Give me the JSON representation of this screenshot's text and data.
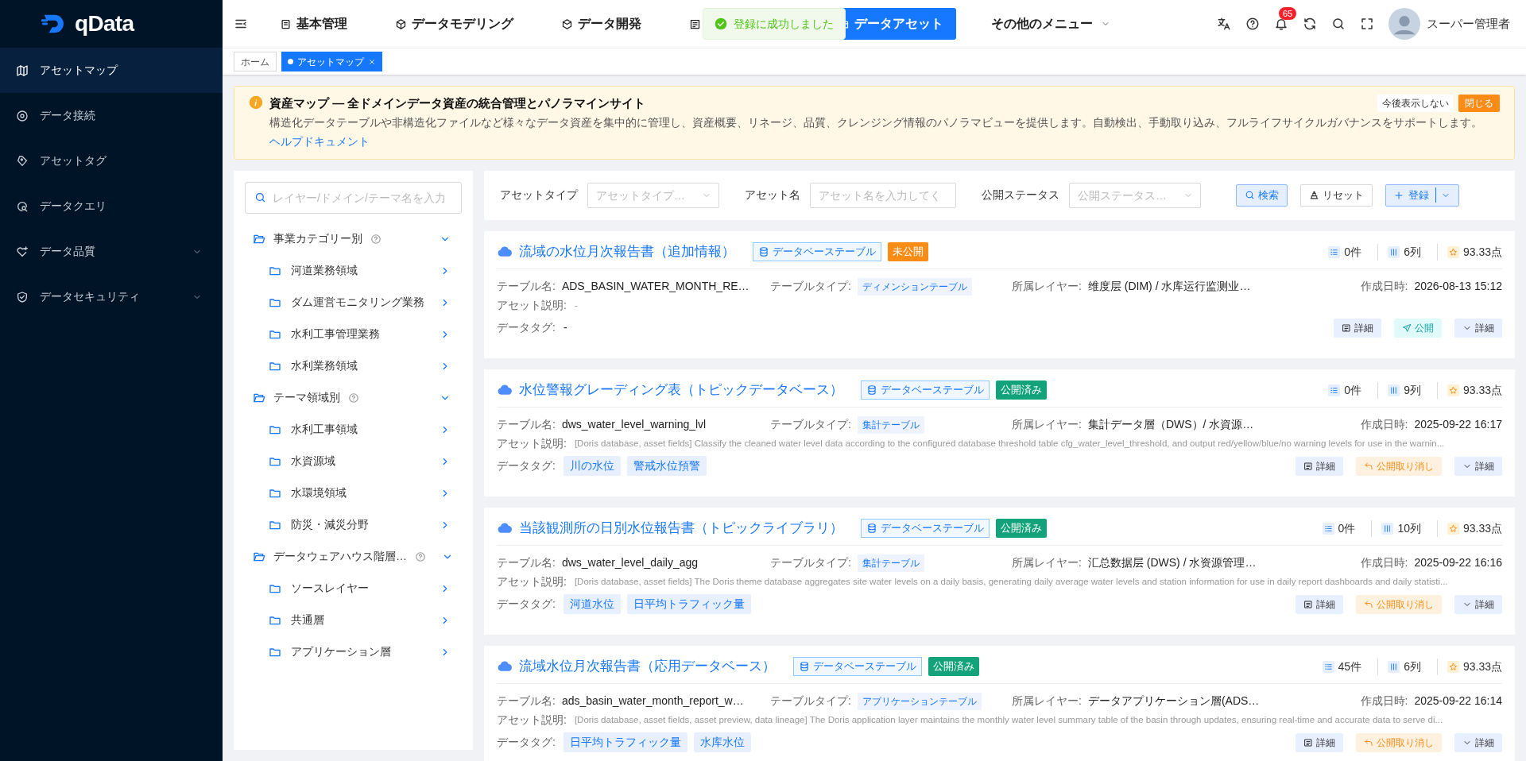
{
  "sidebar": {
    "logo": "qData",
    "items": [
      {
        "label": "アセットマップ",
        "selected": true
      },
      {
        "label": "データ接続",
        "selected": false
      },
      {
        "label": "アセットタグ",
        "selected": false
      },
      {
        "label": "データクエリ",
        "selected": false
      },
      {
        "label": "データ品質",
        "selected": false,
        "expanded": false
      },
      {
        "label": "データセキュリティ",
        "selected": false,
        "expanded": false
      }
    ]
  },
  "top_nav": {
    "items": [
      {
        "label": "基本管理",
        "selected": false
      },
      {
        "label": "データモデリング",
        "selected": false
      },
      {
        "label": "データ開発",
        "selected": false
      },
      {
        "selected": false,
        "kind": "covered"
      },
      {
        "label": "データアセット",
        "selected": true
      },
      {
        "label": "その他のメニュー",
        "selected": false,
        "kind": "dropdown"
      }
    ],
    "notification_count": "65",
    "user": "スーパー管理者"
  },
  "toast": {
    "message": "登録に成功しました"
  },
  "page_tabs": [
    {
      "label": "ホーム",
      "selected": false
    },
    {
      "label": "アセットマップ",
      "selected": true
    }
  ],
  "banner": {
    "title": "資産マップ — 全ドメインデータ資産の統合管理とパノラマインサイト",
    "text": "構造化データテーブルや非構造化ファイルなど様々なデータ資産を集中的に管理し、資産概要、リネージ、品質、クレンジング情報のパノラマビューを提供します。自動検出、手動取り込み、フルライフサイクルガバナンスをサポートします。",
    "link": "ヘルプドキュメント",
    "dismiss": "今後表示しない",
    "close": "閉じる"
  },
  "tree": {
    "search_placeholder": "レイヤー/ドメイン/テーマ名を入力",
    "groups": [
      {
        "label": "事業カテゴリー別",
        "expanded": true,
        "children": [
          {
            "label": "河道業務領域"
          },
          {
            "label": "ダム運営モニタリング業務"
          },
          {
            "label": "水利工事管理業務"
          },
          {
            "label": "水利業務領域"
          }
        ]
      },
      {
        "label": "テーマ領域別",
        "expanded": true,
        "children": [
          {
            "label": "水利工事領域"
          },
          {
            "label": "水資源域"
          },
          {
            "label": "水環境領域"
          },
          {
            "label": "防災・減災分野"
          }
        ]
      },
      {
        "label": "データウェアハウス階層…",
        "expanded": true,
        "children": [
          {
            "label": "ソースレイヤー"
          },
          {
            "label": "共通層"
          },
          {
            "label": "アプリケーション層"
          }
        ]
      }
    ]
  },
  "filters": {
    "fields": [
      {
        "label": "アセットタイプ",
        "placeholder": "アセットタイプ…",
        "kind": "select"
      },
      {
        "label": "アセット名",
        "placeholder": "アセット名を入力してく",
        "kind": "input"
      },
      {
        "label": "公開ステータス",
        "placeholder": "公開ステータス…",
        "kind": "select"
      }
    ],
    "search": "検索",
    "reset": "リセット",
    "register": "登録"
  },
  "assets": [
    {
      "title": "流域の水位月次報告書（追加情報）",
      "type": "データベーステーブル",
      "status": {
        "label": "未公開",
        "kind": "unpublished"
      },
      "rows": "0件",
      "columns": "6列",
      "score": "93.33点",
      "labels": {
        "table_name": "テーブル名:",
        "table_type": "テーブルタイプ:",
        "layer": "所属レイヤー:",
        "created": "作成日時:",
        "description": "アセット説明:",
        "tags": "データタグ:"
      },
      "table_name": "ADS_BASIN_WATER_MONTH_RE…",
      "table_type": "ディメンションテーブル",
      "layer": "维度层 (DIM) / 水库运行监测业…",
      "created": "2026-08-13 15:12",
      "description": "-",
      "no_tags": "-",
      "actions": [
        {
          "label": "詳細",
          "kind": "detail"
        },
        {
          "label": "公開",
          "kind": "publish"
        },
        {
          "label": "詳細",
          "kind": "more"
        }
      ]
    },
    {
      "title": "水位警報グレーディング表（トピックデータベース）",
      "type": "データベーステーブル",
      "status": {
        "label": "公開済み",
        "kind": "published"
      },
      "rows": "0件",
      "columns": "9列",
      "score": "93.33点",
      "labels": {
        "table_name": "テーブル名:",
        "table_type": "テーブルタイプ:",
        "layer": "所属レイヤー:",
        "created": "作成日時:",
        "description": "アセット説明:",
        "tags": "データタグ:"
      },
      "table_name": "dws_water_level_warning_lvl",
      "table_type": "集計テーブル",
      "layer": "集計データ層（DWS）/ 水資源…",
      "created": "2025-09-22 16:17",
      "description": "[Doris database, asset fields] Classify the cleaned water level data according to the configured database threshold table cfg_water_level_threshold, and output red/yellow/blue/no warning levels for use in the warnin...",
      "tags": [
        "川の水位",
        "警戒水位預警"
      ],
      "actions": [
        {
          "label": "詳細",
          "kind": "detail"
        },
        {
          "label": "公開取り消し",
          "kind": "unpublish"
        },
        {
          "label": "詳細",
          "kind": "more"
        }
      ]
    },
    {
      "title": "当該観測所の日別水位報告書（トピックライブラリ）",
      "type": "データベーステーブル",
      "status": {
        "label": "公開済み",
        "kind": "published"
      },
      "rows": "0件",
      "columns": "10列",
      "score": "93.33点",
      "labels": {
        "table_name": "テーブル名:",
        "table_type": "テーブルタイプ:",
        "layer": "所属レイヤー:",
        "created": "作成日時:",
        "description": "アセット説明:",
        "tags": "データタグ:"
      },
      "table_name": "dws_water_level_daily_agg",
      "table_type": "集計テーブル",
      "layer": "汇总数据层 (DWS) / 水资源管理…",
      "created": "2025-09-22 16:16",
      "description": "[Doris database, asset fields] The Doris theme database aggregates site water levels on a daily basis, generating daily average water levels and station information for use in daily report dashboards and daily statisti...",
      "tags": [
        "河道水位",
        "日平均トラフィック量"
      ],
      "actions": [
        {
          "label": "詳細",
          "kind": "detail"
        },
        {
          "label": "公開取り消し",
          "kind": "unpublish"
        },
        {
          "label": "詳細",
          "kind": "more"
        }
      ]
    },
    {
      "title": "流域水位月次報告書（応用データベース）",
      "type": "データベーステーブル",
      "status": {
        "label": "公開済み",
        "kind": "published"
      },
      "rows": "45件",
      "columns": "6列",
      "score": "93.33点",
      "labels": {
        "table_name": "テーブル名:",
        "table_type": "テーブルタイプ:",
        "layer": "所属レイヤー:",
        "created": "作成日時:",
        "description": "アセット説明:",
        "tags": "データタグ:"
      },
      "table_name": "ads_basin_water_month_report_w…",
      "table_type": "アプリケーションテーブル",
      "layer": "データアプリケーション層(ADS…",
      "created": "2025-09-22 16:14",
      "description": "[Doris database, asset fields, asset preview, data lineage] The Doris application layer maintains the monthly water level summary table of the basin through updates, ensuring real-time and accurate data to serve di...",
      "tags": [
        "日平均トラフィック量",
        "水库水位"
      ],
      "actions": [
        {
          "label": "詳細",
          "kind": "detail"
        },
        {
          "label": "公開取り消し",
          "kind": "unpublish"
        },
        {
          "label": "詳細",
          "kind": "more"
        }
      ]
    }
  ]
}
